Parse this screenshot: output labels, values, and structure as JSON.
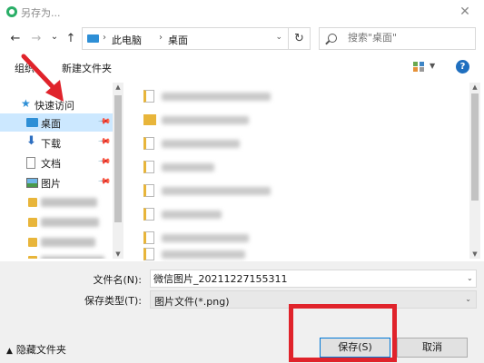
{
  "window": {
    "title": "另存为...",
    "close_glyph": "✕"
  },
  "nav": {
    "back_glyph": "←",
    "forward_glyph": "→",
    "dropdown_glyph": "⌄",
    "up_glyph": "↑",
    "breadcrumb": [
      "此电脑",
      "桌面"
    ],
    "refresh_glyph": "↻",
    "search_placeholder": "搜索\"桌面\""
  },
  "toolbar": {
    "organize_label": "组织",
    "new_folder_label": "新建文件夹",
    "help_label": "?"
  },
  "sidebar": {
    "items": [
      {
        "label": "快速访问",
        "icon": "star-icon"
      },
      {
        "label": "桌面",
        "icon": "desktop-icon",
        "selected": true,
        "pinned": true
      },
      {
        "label": "下载",
        "icon": "download-icon",
        "pinned": true
      },
      {
        "label": "文档",
        "icon": "document-icon",
        "pinned": true
      },
      {
        "label": "图片",
        "icon": "picture-icon",
        "pinned": true
      }
    ]
  },
  "form": {
    "filename_label": "文件名(N):",
    "filename_value": "微信图片_20211227155311",
    "filetype_label": "保存类型(T):",
    "filetype_value": "图片文件(*.png)"
  },
  "footer": {
    "hide_folders_label": "隐藏文件夹",
    "save_label": "保存(S)",
    "cancel_label": "取消"
  },
  "colors": {
    "annotation_red": "#e0232b",
    "selection_blue": "#cce8ff",
    "accent_blue": "#0078d7"
  }
}
